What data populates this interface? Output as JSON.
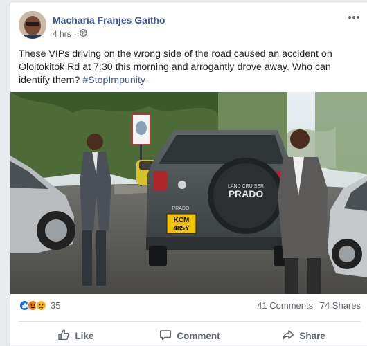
{
  "post": {
    "author": "Macharia Franjes Gaitho",
    "time": "4 hrs",
    "privacy_icon": "globe-icon",
    "text": "These VIPs driving on the wrong side of the road caused an accident on Oloitokitok Rd at 7:30 this morning and arrogantly drove away. Who can identify them?",
    "hashtag": "#StopImpunity"
  },
  "photo": {
    "plate_top": "KCM",
    "plate_bottom": "485Y",
    "tire_cover_small": "LAND CRUISER",
    "tire_cover_big": "PRADO",
    "tailgate_badge": "PRADO"
  },
  "stats": {
    "reactions_count": "35",
    "reaction_types": [
      "like",
      "angry",
      "sad"
    ],
    "comments": "41 Comments",
    "shares": "74 Shares"
  },
  "actions": {
    "like": "Like",
    "comment": "Comment",
    "share": "Share"
  },
  "colors": {
    "link_blue": "#385898",
    "like_blue": "#1877f2",
    "angry_orange": "#e9710f",
    "sad_yellow": "#f7b125",
    "plate_yellow": "#f5c400"
  }
}
